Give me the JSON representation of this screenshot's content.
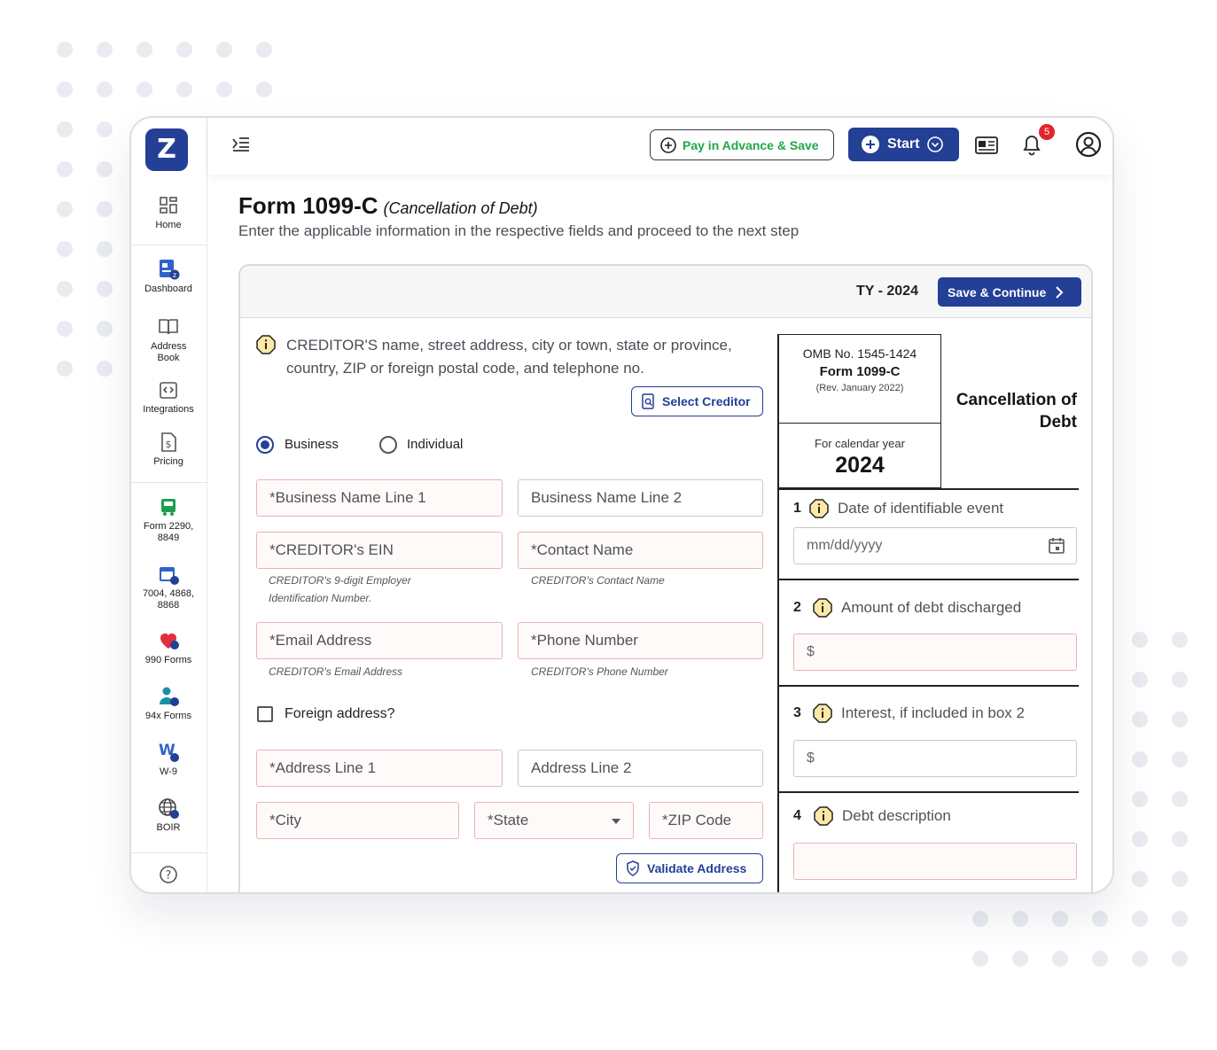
{
  "sidebar": {
    "logo": "Z",
    "items": [
      {
        "label": "Home",
        "icon": "home-grid-icon"
      },
      {
        "label": "Dashboard",
        "icon": "dashboard-icon"
      },
      {
        "label": "Address Book",
        "icon": "address-book-icon"
      },
      {
        "label": "Integrations",
        "icon": "integrations-icon"
      },
      {
        "label": "Pricing",
        "icon": "pricing-icon"
      },
      {
        "label": "Form 2290, 8849",
        "icon": "truck-icon"
      },
      {
        "label": "7004, 4868, 8868",
        "icon": "calendar-icon"
      },
      {
        "label": "990 Forms",
        "icon": "heart-icon"
      },
      {
        "label": "94x Forms",
        "icon": "person-icon"
      },
      {
        "label": "W-9",
        "icon": "w9-icon"
      },
      {
        "label": "BOIR",
        "icon": "globe-icon"
      },
      {
        "label": "",
        "icon": "help-icon"
      }
    ]
  },
  "topbar": {
    "pay_label": "Pay in Advance & Save",
    "start_label": "Start",
    "notification_count": "5"
  },
  "page": {
    "title": "Form 1099-C",
    "title_sub": "(Cancellation of Debt)",
    "description": "Enter the applicable information in the respective fields and proceed to the next step"
  },
  "card": {
    "tax_year": "TY - 2024",
    "save_label": "Save & Continue"
  },
  "creditor": {
    "label": "CREDITOR'S name, street address, city or town, state or province, country, ZIP or foreign postal code, and telephone no.",
    "select_label": "Select Creditor",
    "type_options": [
      "Business",
      "Individual"
    ],
    "selected_type": "Business",
    "fields": {
      "business_name_1": "*Business Name Line 1",
      "business_name_2": "Business Name Line 2",
      "ein": "*CREDITOR's EIN",
      "ein_hint": "CREDITOR's 9-digit Employer Identification Number.",
      "contact_name": "*Contact Name",
      "contact_hint": "CREDITOR's Contact Name",
      "email": "*Email Address",
      "email_hint": "CREDITOR's Email Address",
      "phone": "*Phone Number",
      "phone_hint": "CREDITOR's Phone Number",
      "foreign_label": "Foreign address?",
      "address_1": "*Address Line 1",
      "address_2": "Address Line 2",
      "city": "*City",
      "state": "*State",
      "zip": "*ZIP Code"
    },
    "validate_label": "Validate Address"
  },
  "form_info": {
    "omb": "OMB No. 1545-1424",
    "form": "Form 1099-C",
    "rev": "(Rev. January 2022)",
    "calendar_label": "For calendar year",
    "calendar_year": "2024",
    "title": "Cancellation of Debt"
  },
  "boxes": [
    {
      "num": "1",
      "label": "Date of identifiable event",
      "placeholder": "mm/dd/yyyy"
    },
    {
      "num": "2",
      "label": "Amount of debt discharged",
      "placeholder": "$"
    },
    {
      "num": "3",
      "label": "Interest, if included in box 2",
      "placeholder": "$"
    },
    {
      "num": "4",
      "label": "Debt description",
      "placeholder": ""
    }
  ],
  "colors": {
    "primary": "#233f96",
    "pay_green": "#1fa84a",
    "badge_red": "#e0262b",
    "required_border": "#e9b3b0",
    "info_yellow": "#f2b705"
  }
}
